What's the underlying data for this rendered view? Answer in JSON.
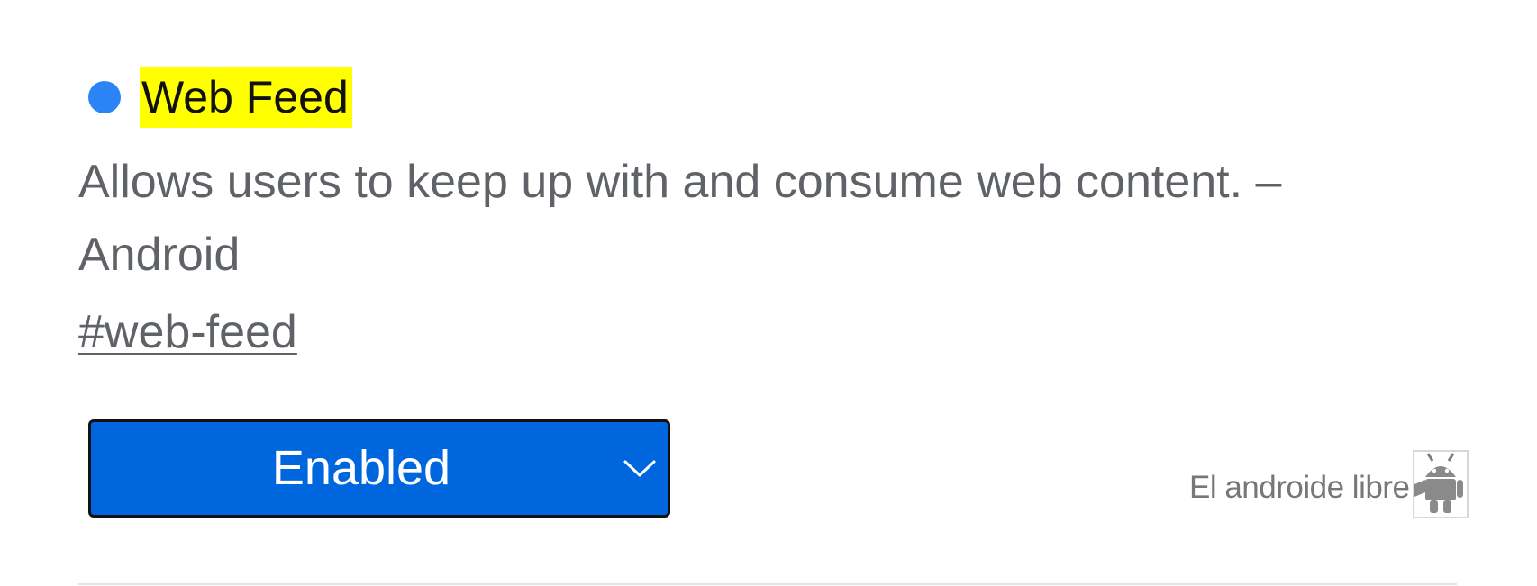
{
  "flag": {
    "name": "Web Feed",
    "description": "Allows users to keep up with and consume web content. – Android",
    "tag": "#web-feed",
    "state": "Enabled",
    "status_color": "#2a84f5",
    "highlight_color": "#ffff00",
    "select_color": "#0066dd"
  },
  "icons": {
    "status": "status-dot",
    "dropdown": "chevron-down-icon",
    "watermark": "android-robot-logo"
  },
  "watermark": {
    "text": "El androide libre"
  }
}
